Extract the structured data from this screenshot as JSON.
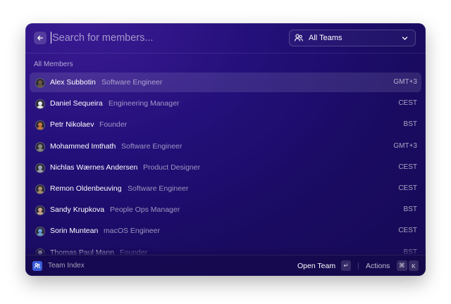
{
  "search": {
    "placeholder": "Search for members...",
    "value": ""
  },
  "team_filter": {
    "selected": "All Teams",
    "icon": "people-icon"
  },
  "section_title": "All Members",
  "members": [
    {
      "name": "Alex Subbotin",
      "role": "Software Engineer",
      "tz": "GMT+3",
      "selected": true,
      "avatar_color": "#6b5a3f"
    },
    {
      "name": "Daniel Sequeira",
      "role": "Engineering Manager",
      "tz": "CEST",
      "avatar_color": "#e8e8e8"
    },
    {
      "name": "Petr Nikolaev",
      "role": "Founder",
      "tz": "BST",
      "avatar_color": "#c7783a"
    },
    {
      "name": "Mohammed Imthath",
      "role": "Software Engineer",
      "tz": "GMT+3",
      "avatar_color": "#8a8a80"
    },
    {
      "name": "Nichlas Wærnes Andersen",
      "role": "Product Designer",
      "tz": "CEST",
      "avatar_color": "#9aa4b0"
    },
    {
      "name": "Remon Oldenbeuving",
      "role": "Software Engineer",
      "tz": "CEST",
      "avatar_color": "#a88f6a"
    },
    {
      "name": "Sandy Krupkova",
      "role": "People Ops Manager",
      "tz": "BST",
      "avatar_color": "#c9a489"
    },
    {
      "name": "Sorin Muntean",
      "role": "macOS Engineer",
      "tz": "CEST",
      "avatar_color": "#6a9bd1"
    },
    {
      "name": "Thomas Paul Mann",
      "role": "Founder",
      "tz": "BST",
      "avatar_color": "#e6e6e6"
    }
  ],
  "footer": {
    "app_name": "Team Index",
    "primary_action": "Open Team",
    "primary_shortcut": "↵",
    "actions_label": "Actions",
    "actions_shortcut": [
      "⌘",
      "K"
    ]
  },
  "colors": {
    "background": "#1c0c66",
    "selection": "#3a2a82",
    "accent": "#3a5bd9"
  }
}
